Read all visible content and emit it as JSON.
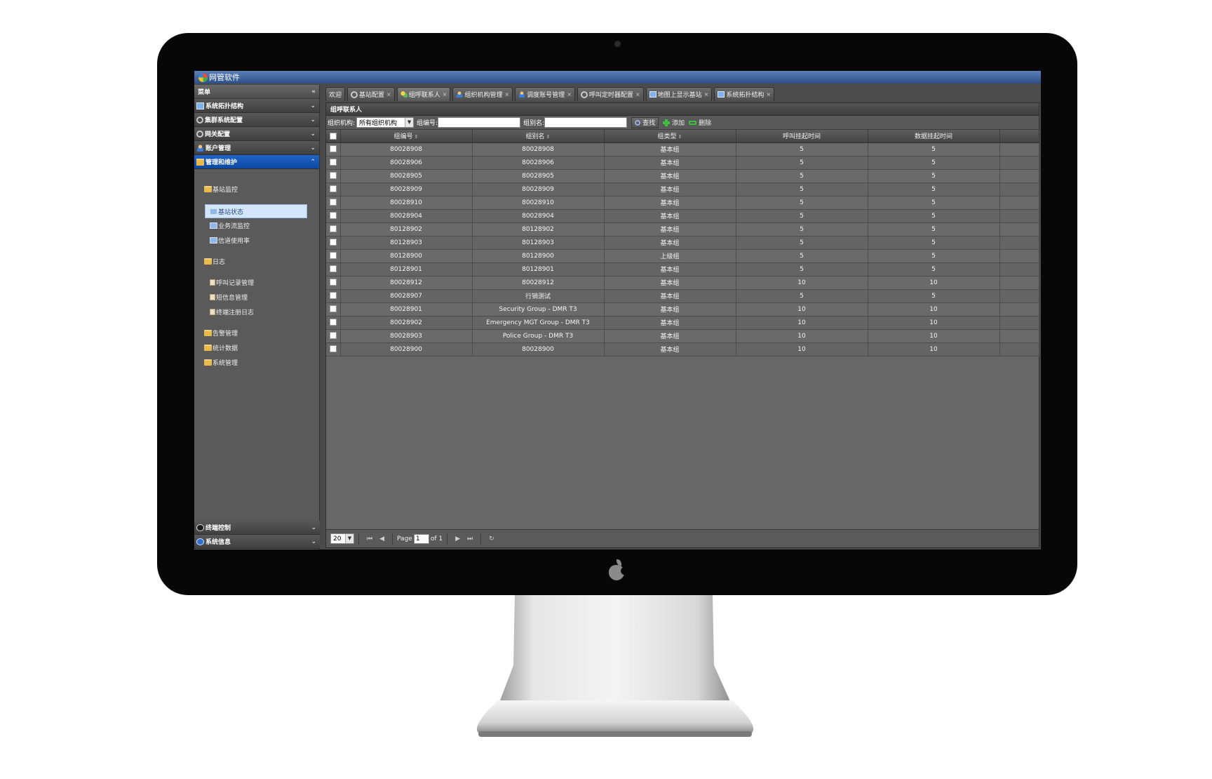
{
  "app": {
    "title": "网管软件"
  },
  "sidebar": {
    "header": "菜单",
    "collapse_glyph": "«",
    "groups": [
      {
        "label": "系统拓扑结构",
        "icon": "screen-icon"
      },
      {
        "label": "集群系统配置",
        "icon": "gear-icon"
      },
      {
        "label": "网关配置",
        "icon": "gear-icon"
      },
      {
        "label": "账户管理",
        "icon": "user-icon"
      },
      {
        "label": "管理和维护",
        "icon": "folder-icon",
        "active": true
      }
    ],
    "tree": {
      "folder_bs_monitor": "基站监控",
      "bs_status": "基站状态",
      "traffic_monitor": "业务流监控",
      "channel_usage": "信道使用率",
      "folder_log": "日志",
      "call_record": "呼叫记录管理",
      "sms_mgmt": "短信息管理",
      "terminal_reg_log": "终端注册日志",
      "alarm_mgmt": "告警管理",
      "stats_data": "统计数据",
      "sys_mgmt": "系统管理"
    },
    "bottom_groups": [
      {
        "label": "终端控制",
        "icon": "terminal-icon"
      },
      {
        "label": "系统信息",
        "icon": "info-icon"
      }
    ]
  },
  "tabs": [
    {
      "label": "欢迎",
      "closable": false
    },
    {
      "label": "基站配置",
      "closable": true
    },
    {
      "label": "组呼联系人",
      "closable": true,
      "active": true
    },
    {
      "label": "组织机构管理",
      "closable": true
    },
    {
      "label": "调度账号管理",
      "closable": true
    },
    {
      "label": "呼叫定时器配置",
      "closable": true
    },
    {
      "label": "地图上显示基站",
      "closable": true
    },
    {
      "label": "系统拓扑结构",
      "closable": true
    }
  ],
  "panel": {
    "title": "组呼联系人",
    "filters": {
      "org_label": "组织机构:",
      "org_value": "所有组织机构",
      "group_no_label": "组编号:",
      "group_name_label": "组别名:",
      "search_button": "查找",
      "add_button": "添加",
      "delete_button": "删除"
    },
    "columns": [
      "组编号",
      "组别名",
      "组类型",
      "呼叫挂起时间",
      "数据挂起时间"
    ],
    "rows": [
      [
        "80028908",
        "80028908",
        "基本组",
        "5",
        "5"
      ],
      [
        "80028906",
        "80028906",
        "基本组",
        "5",
        "5"
      ],
      [
        "80028905",
        "80028905",
        "基本组",
        "5",
        "5"
      ],
      [
        "80028909",
        "80028909",
        "基本组",
        "5",
        "5"
      ],
      [
        "80028910",
        "80028910",
        "基本组",
        "5",
        "5"
      ],
      [
        "80028904",
        "80028904",
        "基本组",
        "5",
        "5"
      ],
      [
        "80128902",
        "80128902",
        "基本组",
        "5",
        "5"
      ],
      [
        "80128903",
        "80128903",
        "基本组",
        "5",
        "5"
      ],
      [
        "80128900",
        "80128900",
        "上级组",
        "5",
        "5"
      ],
      [
        "80128901",
        "80128901",
        "基本组",
        "5",
        "5"
      ],
      [
        "80028912",
        "80028912",
        "基本组",
        "10",
        "10"
      ],
      [
        "80028907",
        "行销测试",
        "基本组",
        "5",
        "5"
      ],
      [
        "80028901",
        "Security Group - DMR T3",
        "基本组",
        "10",
        "10"
      ],
      [
        "80028902",
        "Emergency MGT Group - DMR T3",
        "基本组",
        "10",
        "10"
      ],
      [
        "80028903",
        "Police Group - DMR T3",
        "基本组",
        "10",
        "10"
      ],
      [
        "80028900",
        "80028900",
        "基本组",
        "10",
        "10"
      ]
    ],
    "pager": {
      "page_size": "20",
      "page_label": "Page",
      "current_page": "1",
      "of_label": "of 1"
    }
  }
}
